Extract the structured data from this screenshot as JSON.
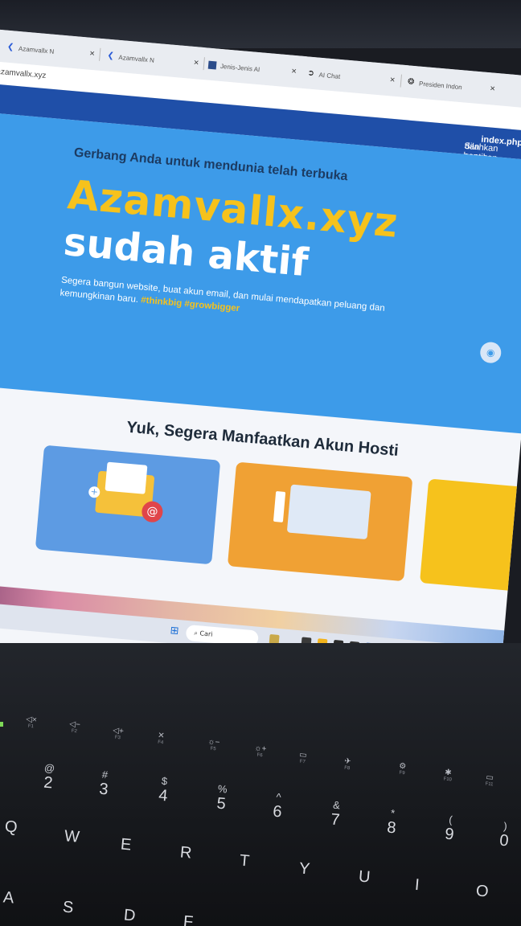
{
  "browser": {
    "tabs": [
      {
        "title": "Azamvallx N",
        "icon": "azamvallx-logo-icon"
      },
      {
        "title": "Azamvallx N",
        "icon": "azamvallx-logo-icon"
      },
      {
        "title": "Jenis-Jenis AI",
        "icon": "site-favicon-icon"
      },
      {
        "title": "AI Chat",
        "icon": "ai-chat-icon"
      },
      {
        "title": "Presiden Indon",
        "icon": "chatgpt-icon"
      }
    ],
    "tab_close": "×",
    "address": "azamvallx.xyz"
  },
  "notice": {
    "text_prefix": "Silahkan hapus file ",
    "file": "index.php",
    "text_suffix": " dan gantikan dengan file website"
  },
  "hero": {
    "subtitle": "Gerbang Anda untuk mendunia telah terbuka",
    "domain": "Azamvallx.xyz",
    "status": "sudah aktif",
    "description": "Segera bangun website, buat akun email, dan mulai mendapatkan peluang dan kemungkinan baru.",
    "tags": "#thinkbig #growbigger"
  },
  "section": {
    "title": "Yuk, Segera Manfaatkan Akun Hosti"
  },
  "taskbar": {
    "search_placeholder": "Cari"
  },
  "keyboard": {
    "fkeys": [
      "F1",
      "F2",
      "F3",
      "F4",
      "F5",
      "F6",
      "F7",
      "F8",
      "F9",
      "F10",
      "F11"
    ],
    "number_row": [
      {
        "top": "@",
        "main": "2"
      },
      {
        "top": "#",
        "main": "3"
      },
      {
        "top": "$",
        "main": "4"
      },
      {
        "top": "%",
        "main": "5"
      },
      {
        "top": "^",
        "main": "6"
      },
      {
        "top": "&",
        "main": "7"
      },
      {
        "top": "*",
        "main": "8"
      },
      {
        "top": "(",
        "main": "9"
      },
      {
        "top": ")",
        "main": "0"
      }
    ],
    "qwerty_row": [
      "Q",
      "W",
      "E",
      "R",
      "T",
      "Y",
      "U",
      "I",
      "O"
    ],
    "home_row": [
      "A",
      "S",
      "D",
      "F"
    ]
  },
  "colors": {
    "hero_bg": "#3d9be9",
    "notice_bg": "#1f4fa8",
    "accent_yellow": "#f6c21c"
  }
}
